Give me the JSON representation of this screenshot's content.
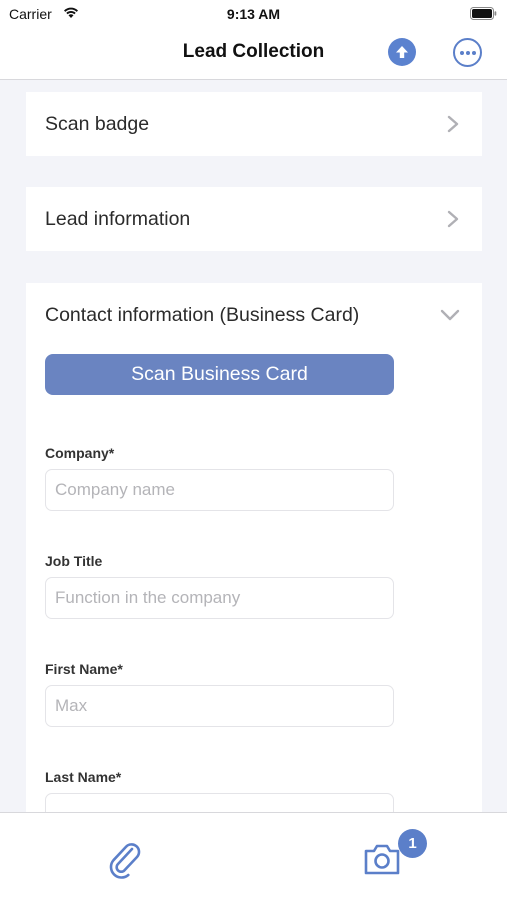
{
  "status_bar": {
    "carrier": "Carrier",
    "time": "9:13 AM"
  },
  "nav": {
    "title": "Lead Collection"
  },
  "sections": {
    "scan_badge": "Scan badge",
    "lead_information": "Lead information",
    "contact_information": "Contact information (Business Card)"
  },
  "contact_form": {
    "scan_button": "Scan Business Card",
    "company": {
      "label": "Company*",
      "placeholder": "Company name",
      "value": ""
    },
    "job_title": {
      "label": "Job Title",
      "placeholder": "Function in the company",
      "value": ""
    },
    "first_name": {
      "label": "First Name*",
      "placeholder": "Max",
      "value": ""
    },
    "last_name": {
      "label": "Last Name*",
      "placeholder": "",
      "value": ""
    }
  },
  "tab_bar": {
    "photo_count": "1"
  },
  "icons": {
    "wifi": "wifi-icon",
    "battery": "battery-icon",
    "upload": "upload-icon",
    "more": "more-icon",
    "chevron_right": "chevron-right-icon",
    "chevron_down": "chevron-down-icon",
    "attachment": "paperclip-icon",
    "camera": "camera-icon"
  },
  "colors": {
    "accent": "#5b7fc9",
    "button": "#6a84c1",
    "background": "#f3f4f9"
  }
}
